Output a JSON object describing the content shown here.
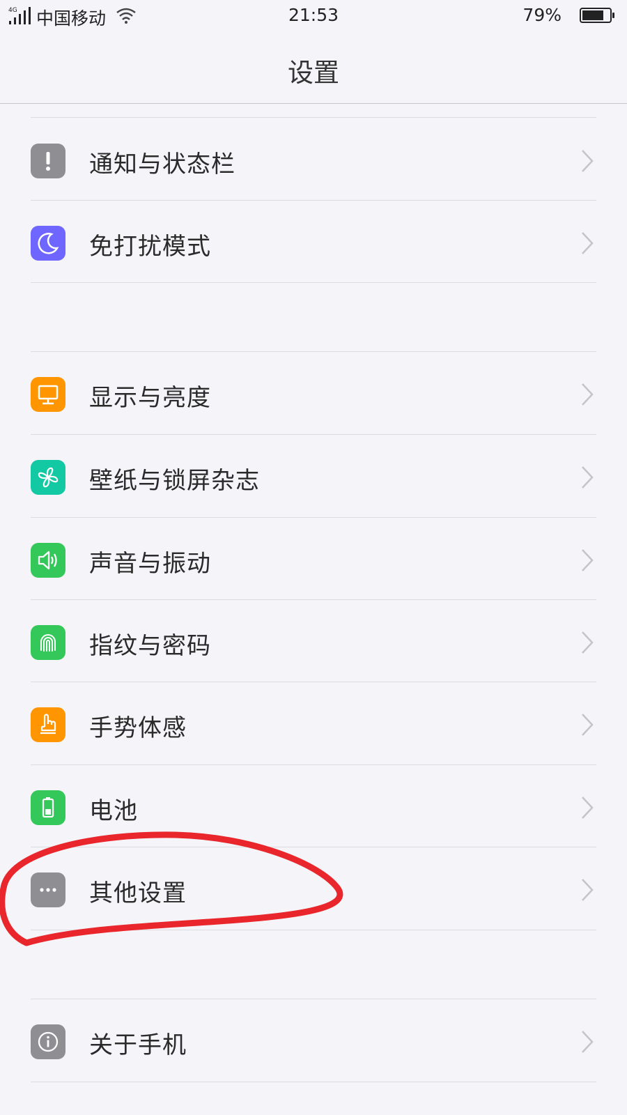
{
  "status_bar": {
    "network": "4G",
    "carrier": "中国移动",
    "time": "21:53",
    "battery_percent": "79%",
    "battery_level": 0.79
  },
  "header": {
    "title": "设置"
  },
  "rows": [
    {
      "label": "通知与状态栏",
      "icon": "exclamation-icon",
      "color": "#8e8e93"
    },
    {
      "label": "免打扰模式",
      "icon": "moon-icon",
      "color": "#6e66ff"
    },
    {
      "label": "显示与亮度",
      "icon": "monitor-icon",
      "color": "#ff9500"
    },
    {
      "label": "壁纸与锁屏杂志",
      "icon": "pinwheel-icon",
      "color": "#12c9a4"
    },
    {
      "label": "声音与振动",
      "icon": "speaker-icon",
      "color": "#34c759"
    },
    {
      "label": "指纹与密码",
      "icon": "fingerprint-icon",
      "color": "#34c759"
    },
    {
      "label": "手势体感",
      "icon": "hand-icon",
      "color": "#ff9500"
    },
    {
      "label": "电池",
      "icon": "battery-icon",
      "color": "#34c759"
    },
    {
      "label": "其他设置",
      "icon": "more-icon",
      "color": "#8e8e93"
    },
    {
      "label": "关于手机",
      "icon": "info-icon",
      "color": "#8e8e93"
    }
  ],
  "annotation": {
    "type": "hand-drawn-circle",
    "color": "#e8262b",
    "target": "其他设置"
  }
}
